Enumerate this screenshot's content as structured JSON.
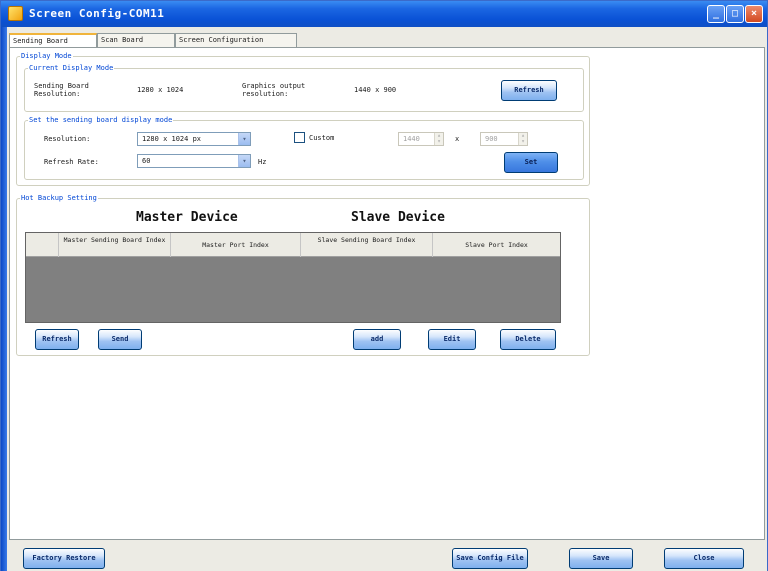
{
  "window": {
    "title": "Screen Config-COM11",
    "controls": {
      "minimize": "_",
      "maximize": "□",
      "close": "×"
    }
  },
  "tabs": [
    {
      "label": "Sending Board",
      "active": true
    },
    {
      "label": "Scan Board",
      "active": false
    },
    {
      "label": "Screen Configuration",
      "active": false
    }
  ],
  "display_mode": {
    "group_label": "Display Mode",
    "current": {
      "group_label": "Current Display Mode",
      "sending_board_res_label": "Sending Board Resolution:",
      "sending_board_res_value": "1280 x 1024",
      "graphics_output_label": "Graphics output resolution:",
      "graphics_output_value": "1440 x 900",
      "refresh_button": "Refresh"
    },
    "set_mode": {
      "group_label": "Set the sending board display mode",
      "resolution_label": "Resolution:",
      "resolution_value": "1280 x 1024 px",
      "refresh_rate_label": "Refresh Rate:",
      "refresh_rate_value": "60",
      "refresh_rate_unit": "Hz",
      "custom_label": "Custom",
      "custom_checked": false,
      "custom_width": "1440",
      "custom_x": "x",
      "custom_height": "900",
      "set_button": "Set"
    }
  },
  "hot_backup": {
    "group_label": "Hot Backup Setting",
    "master_heading": "Master Device",
    "slave_heading": "Slave Device",
    "columns": [
      "Master Sending Board Index",
      "Master Port Index",
      "Slave Sending Board Index",
      "Slave Port Index"
    ],
    "rows": [],
    "buttons": {
      "refresh": "Refresh",
      "send": "Send",
      "add": "add",
      "edit": "Edit",
      "delete": "Delete"
    }
  },
  "footer": {
    "factory_restore": "Factory Restore",
    "save_config_file": "Save Config File",
    "save": "Save",
    "close": "Close"
  },
  "colors": {
    "titlebar": "#0a52d6",
    "button_border": "#003c74",
    "group_label": "#0046d5",
    "table_body": "#808080"
  },
  "icons": [
    "app-icon",
    "minimize-icon",
    "maximize-icon",
    "close-icon",
    "chevron-down-icon"
  ]
}
